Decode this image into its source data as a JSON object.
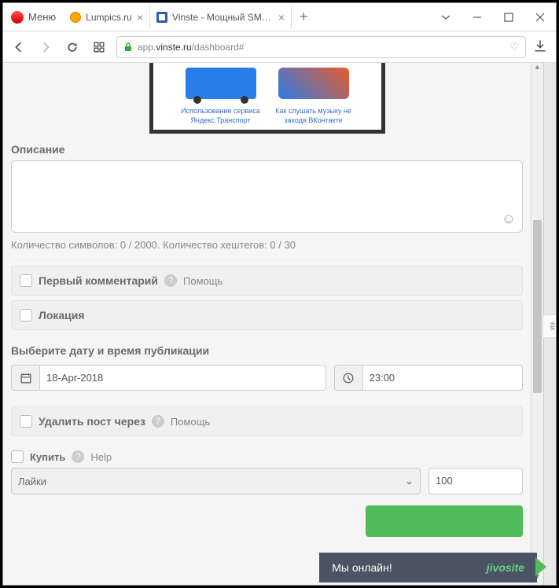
{
  "browser": {
    "menu_label": "Меню",
    "tabs": [
      {
        "title": "Lumpics.ru"
      },
      {
        "title": "Vinste - Мощный SMM-се"
      }
    ],
    "url_prefix": "app.",
    "url_domain": "vinste.ru",
    "url_path": "/dashboard#"
  },
  "preview": {
    "item1": "Использование сервиса Яндекс.Транспорт",
    "item2": "Как слушать музыку не заходя ВКонтакте"
  },
  "description": {
    "label": "Описание",
    "counter": "Количество символов: 0 / 2000. Количество хештегов: 0 / 30"
  },
  "first_comment": {
    "label": "Первый комментарий",
    "help": "Помощь"
  },
  "location": {
    "label": "Локация"
  },
  "pubtime": {
    "label": "Выберите дату и время публикации",
    "date": "18-Apr-2018",
    "time": "23:00"
  },
  "delete_after": {
    "label": "Удалить пост через",
    "help": "Помощь"
  },
  "buy": {
    "label": "Купить",
    "help": "Help",
    "select": "Лайки",
    "qty": "100"
  },
  "sidebar_stub": "ки",
  "jivo": {
    "status": "Мы онлайн!",
    "brand": "jivosite"
  }
}
